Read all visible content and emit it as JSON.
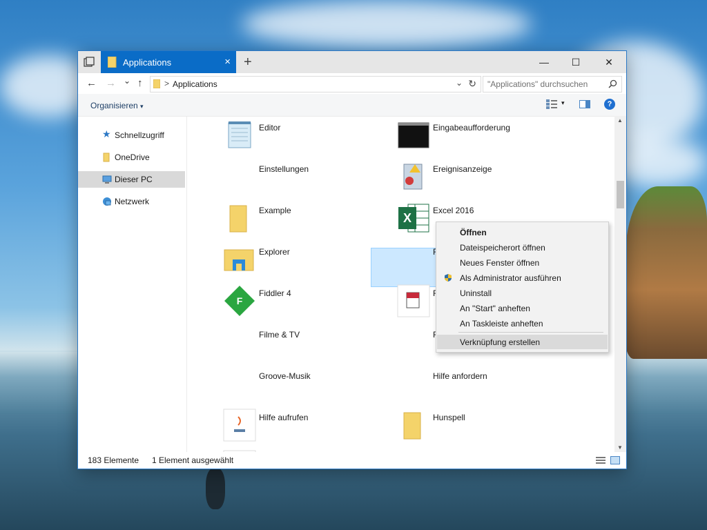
{
  "window": {
    "tab_title": "Applications",
    "close_tab_glyph": "×",
    "new_tab_glyph": "+",
    "minimize_glyph": "—",
    "maximize_glyph": "☐",
    "close_glyph": "✕"
  },
  "nav": {
    "back_glyph": "←",
    "forward_glyph": "→",
    "recent_glyph": "⌄",
    "up_glyph": "↑",
    "breadcrumb": "Applications",
    "breadcrumb_chevron": ">",
    "dropdown_glyph": "⌄",
    "refresh_glyph": "↻",
    "search_placeholder": "\"Applications\" durchsuchen"
  },
  "ribbon": {
    "organize_label": "Organisieren",
    "organize_caret": "▾",
    "view_caret": "▾",
    "help_glyph": "?"
  },
  "sidebar": {
    "items": [
      {
        "label": "Schnellzugriff",
        "icon": "star-icon"
      },
      {
        "label": "OneDrive",
        "icon": "folder-icon"
      },
      {
        "label": "Dieser PC",
        "icon": "computer-icon"
      },
      {
        "label": "Netzwerk",
        "icon": "network-icon"
      }
    ]
  },
  "files": {
    "col1": [
      "Editor",
      "Einstellungen",
      "Example",
      "Explorer",
      "Fiddler 4",
      "Filme & TV",
      "Groove-Musik",
      "Hilfe aufrufen"
    ],
    "col2": [
      "Eingabeaufforderung",
      "Ereignisanzeige",
      "Excel 2016",
      "F",
      "F",
      "F",
      "Hilfe anfordern",
      "Hunspell"
    ],
    "fiddler_letter": "F",
    "excel_letter": "X"
  },
  "status": {
    "count": "183 Elemente",
    "selection": "1 Element ausgewählt"
  },
  "context_menu": {
    "items": [
      "Öffnen",
      "Dateispeicherort öffnen",
      "Neues Fenster öffnen",
      "Als Administrator ausführen",
      "Uninstall",
      "An \"Start\" anheften",
      "An Taskleiste anheften",
      "Verknüpfung erstellen"
    ]
  },
  "colors": {
    "accent": "#0a6cc7",
    "selection": "#cce8ff",
    "excel_green": "#1e7145",
    "fiddler_green": "#2aa640"
  }
}
